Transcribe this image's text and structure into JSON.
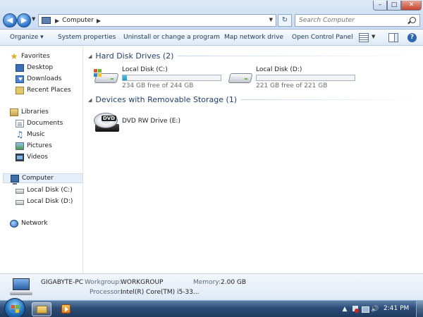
{
  "address_bar": {
    "path": "Computer",
    "search_placeholder": "Search Computer"
  },
  "window_controls": {
    "minimize": "–",
    "maximize": "□",
    "close": "✕"
  },
  "toolbar": {
    "organize": "Organize ▾",
    "system_properties": "System properties",
    "uninstall": "Uninstall or change a program",
    "map_drive": "Map network drive",
    "control_panel": "Open Control Panel",
    "help": "?"
  },
  "navigation": {
    "favorites": {
      "label": "Favorites",
      "items": [
        "Desktop",
        "Downloads",
        "Recent Places"
      ]
    },
    "libraries": {
      "label": "Libraries",
      "items": [
        "Documents",
        "Music",
        "Pictures",
        "Videos"
      ]
    },
    "computer": {
      "label": "Computer",
      "items": [
        "Local Disk (C:)",
        "Local Disk (D:)"
      ]
    },
    "network": {
      "label": "Network"
    }
  },
  "groups": {
    "hard_disks": {
      "title": "Hard Disk Drives (2)",
      "drives": [
        {
          "name": "Local Disk (C:)",
          "free_text": "234 GB free of 244 GB",
          "used_fraction": 0.04
        },
        {
          "name": "Local Disk (D:)",
          "free_text": "221 GB free of 221 GB",
          "used_fraction": 0.0
        }
      ]
    },
    "removable": {
      "title": "Devices with Removable Storage (1)",
      "drives": [
        {
          "name": "DVD RW Drive (E:)",
          "badge": "DVD"
        }
      ]
    }
  },
  "details": {
    "pc_name": "GIGABYTE-PC",
    "workgroup_label": "Workgroup:",
    "workgroup_value": "WORKGROUP",
    "memory_label": "Memory:",
    "memory_value": "2.00 GB",
    "processor_label": "Processor:",
    "processor_value": "Intel(R) Core(TM) i5-33..."
  },
  "taskbar": {
    "clock": "2:41 PM"
  },
  "colors": {
    "accent": "#1e3f73",
    "progress_fill": "#26a0da"
  }
}
